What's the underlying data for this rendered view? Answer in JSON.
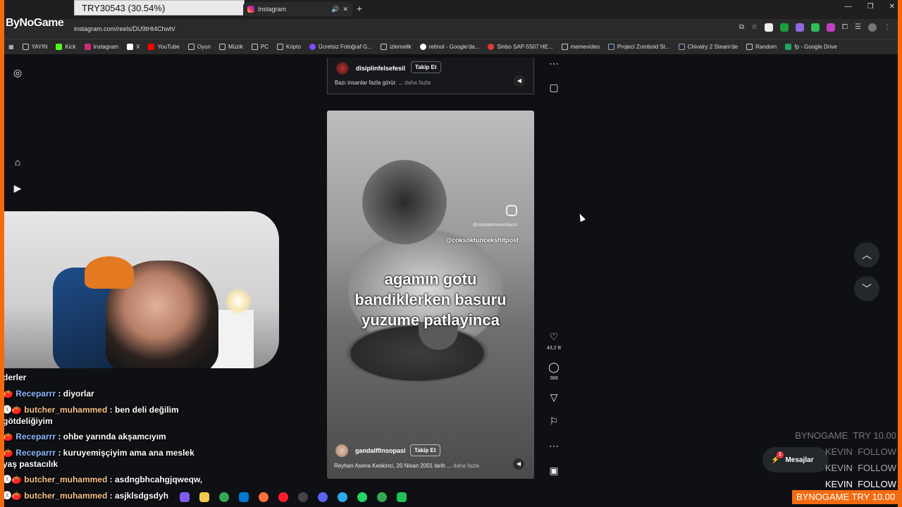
{
  "overlay": {
    "donation_text": "TRY30543 (30.54%)",
    "stream_logo": "ByNoGame"
  },
  "browser": {
    "tab_title": "Instagram",
    "new_tab": "+",
    "url": "instagram.com/reels/DU9tHt4Chwh/",
    "bookmarks": [
      {
        "label": "YAYIN",
        "icon": "folder-icon"
      },
      {
        "label": "Kick",
        "icon": "kick-icon"
      },
      {
        "label": "Instagram",
        "icon": "instagram-icon"
      },
      {
        "label": "X",
        "icon": "x-icon"
      },
      {
        "label": "YouTube",
        "icon": "youtube-icon"
      },
      {
        "label": "Oyun",
        "icon": "folder-icon"
      },
      {
        "label": "Müzik",
        "icon": "folder-icon"
      },
      {
        "label": "PC",
        "icon": "folder-icon"
      },
      {
        "label": "Kripto",
        "icon": "folder-icon"
      },
      {
        "label": "Ücretsiz Fotoğraf G...",
        "icon": "site-icon"
      },
      {
        "label": "izlemelik",
        "icon": "folder-icon"
      },
      {
        "label": "retinol - Google'da...",
        "icon": "google-icon"
      },
      {
        "label": "Sinbo SAP-5507 HE...",
        "icon": "site-icon"
      },
      {
        "label": "memevideo",
        "icon": "folder-icon"
      },
      {
        "label": "Project Zomboid St...",
        "icon": "steam-icon"
      },
      {
        "label": "Chivalry 2 Steam'de",
        "icon": "steam-icon"
      },
      {
        "label": "Random",
        "icon": "folder-icon"
      },
      {
        "label": "fp - Google Drive",
        "icon": "drive-icon"
      }
    ]
  },
  "reel_top": {
    "username": "disiplinfelsefesil",
    "follow": "Takip Et",
    "caption": "Bazı insanlar fazla görür. ...",
    "more": "daha fazla"
  },
  "reel": {
    "watermark_small": "@coksoktuncekshitpost",
    "watermark_handle": "@coksoktuncekshitpost",
    "overlay_lines": [
      "agamın gotu",
      "bandiklerken basuru",
      "yuzume patlayinca"
    ],
    "username": "gandalffinsopasi",
    "follow": "Takip Et",
    "caption": "Reyhan Asena Keskinci, 20 Nisan 2001 tarih ...",
    "more": "daha fazla"
  },
  "actions": {
    "likes": "43,2 B",
    "comments": "388"
  },
  "messages": {
    "label": "Mesajlar",
    "badge": "1"
  },
  "chat": [
    {
      "user": "",
      "text": "derler"
    },
    {
      "user": "Receparrr",
      "text": ": diyorlar"
    },
    {
      "user": "butcher_muhammed",
      "text": ": ben deli değilim"
    },
    {
      "user": "",
      "text": "götdeliğiyim"
    },
    {
      "user": "Receparrr",
      "text": ": ohbe yarında akşamcıyım"
    },
    {
      "user": "Receparrr",
      "text": ": kuruyemişçiyim ama ana meslek"
    },
    {
      "user": "",
      "text": "yaş pastacılık"
    },
    {
      "user": "butcher_muhammed",
      "text": ": asdngbhcahgjqweqw,"
    },
    {
      "user": "butcher_muhammed",
      "text": ": asjklsdgsdyh"
    }
  ],
  "alerts": [
    {
      "name": "BYNOGAME",
      "detail": "TRY 10.00"
    },
    {
      "name": "KEVIN",
      "detail": "FOLLOW"
    },
    {
      "name": "KEVIN",
      "detail": "FOLLOW"
    },
    {
      "name": "KEVIN",
      "detail": "FOLLOW"
    }
  ],
  "bottom_alert": "BYNOGAME TRY 10.00"
}
